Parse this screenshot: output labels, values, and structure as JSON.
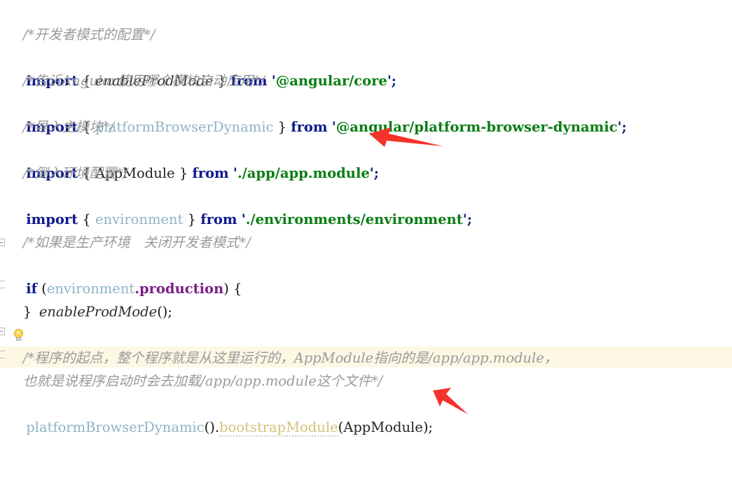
{
  "editor": {
    "background": "#ffffff",
    "highlight_color": "#fdf8e4",
    "font_size_px": 19.5,
    "line_height_px": 33,
    "colors": {
      "keyword": "#0d1a8c",
      "string": "#0a7d14",
      "comment": "#9a9a9a",
      "identifier": "#8fb3c7",
      "property": "#7b1f86",
      "method": "#d4c27a",
      "annotation_arrow": "#f5332a"
    }
  },
  "code": {
    "language": "TypeScript",
    "lines": [
      {
        "index": 0,
        "type": "comment",
        "text": "/*开发者模式的配置*/"
      },
      {
        "index": 1,
        "type": "code",
        "keyword1": "import",
        "brace_open": " { ",
        "name": "enableProdMode",
        "brace_close": " } ",
        "keyword2": "from",
        "space": " ",
        "quote_open": "'",
        "string": "@angular/core",
        "quote_close": "'",
        "semicolon": ";"
      },
      {
        "index": 2,
        "type": "comment",
        "text": "/*告诉Angular使用哪个模块启动应用*/"
      },
      {
        "index": 3,
        "type": "code",
        "keyword1": "import",
        "brace_open": " { ",
        "name": "platformBrowserDynamic",
        "brace_close": " } ",
        "keyword2": "from",
        "space": " ",
        "quote_open": "'",
        "string": "@angular/platform-browser-dynamic",
        "quote_close": "'",
        "semicolon": ";"
      },
      {
        "index": 4,
        "type": "comment",
        "text": "/*导入主模块*/"
      },
      {
        "index": 5,
        "type": "code",
        "keyword1": "import",
        "brace_open": " { ",
        "name": "AppModule",
        "brace_close": " } ",
        "keyword2": "from",
        "space": " ",
        "quote_open": "'",
        "string": "./app/app.module",
        "quote_close": "'",
        "semicolon": ";"
      },
      {
        "index": 6,
        "type": "comment",
        "text": "/*倒入环境配置*/"
      },
      {
        "index": 7,
        "type": "code",
        "keyword1": "import",
        "brace_open": " { ",
        "name": "environment",
        "brace_close": " } ",
        "keyword2": "from",
        "space": " ",
        "quote_open": "'",
        "string": "./environments/environment",
        "quote_close": "'",
        "semicolon": ";"
      },
      {
        "index": 8,
        "type": "blank",
        "text": ""
      },
      {
        "index": 9,
        "type": "blank",
        "text": ""
      },
      {
        "index": 10,
        "type": "comment",
        "text": "/*如果是生产环境　关闭开发者模式*/"
      },
      {
        "index": 11,
        "type": "if",
        "keyword": "if",
        "paren_open": " (",
        "object": "environment",
        "dot": ".",
        "property": "production",
        "paren_close": ")",
        "brace": " {"
      },
      {
        "index": 12,
        "type": "call",
        "indent": "   ",
        "fn": "enableProdMode",
        "tail": "();"
      },
      {
        "index": 13,
        "type": "closebrace",
        "text": "}"
      },
      {
        "index": 14,
        "type": "blank",
        "text": ""
      },
      {
        "index": 15,
        "type": "comment",
        "text": "/*程序的起点，整个程序就是从这里运行的，AppModule指向的是/app/app.module，"
      },
      {
        "index": 16,
        "type": "comment",
        "highlighted": true,
        "text": "也就是说程序启动时会去加载/app/app.module这个文件*/"
      },
      {
        "index": 17,
        "type": "bootstrap",
        "object": "platformBrowserDynamic",
        "parens": "()",
        "dot": ".",
        "method": "bootstrapModule",
        "arg_open": "(",
        "arg": "AppModule",
        "arg_close": ")",
        "semicolon": ";"
      }
    ]
  },
  "annotations": {
    "arrows": [
      {
        "id": "arrow-app-module",
        "points_to": "./app/app.module",
        "color": "#f5332a"
      },
      {
        "id": "arrow-bootstrap-arg",
        "points_to": "AppModule",
        "color": "#f5332a"
      }
    ],
    "intention_bulb": {
      "name": "lightbulb-icon",
      "tooltip": "Show intention actions"
    }
  }
}
